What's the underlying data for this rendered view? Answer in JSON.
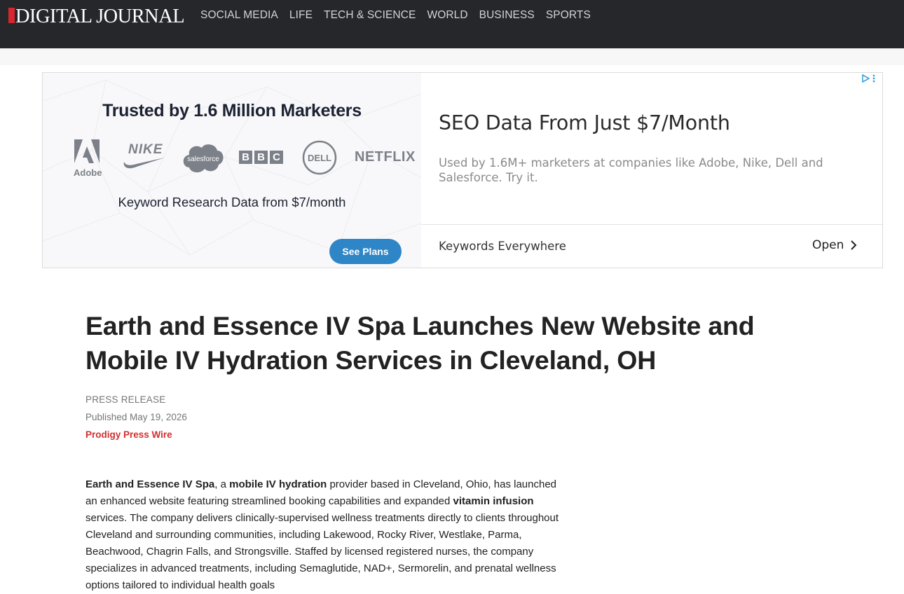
{
  "site": {
    "logo_text": "DIGITAL JOURNAL",
    "brand_color": "#d7262e",
    "nav": [
      "SOCIAL MEDIA",
      "LIFE",
      "TECH & SCIENCE",
      "WORLD",
      "BUSINESS",
      "SPORTS"
    ]
  },
  "ad": {
    "left": {
      "headline": "Trusted by 1.6 Million Marketers",
      "brands": [
        "Adobe",
        "NIKE",
        "salesforce",
        "BBC",
        "DELL",
        "NETFLIX"
      ],
      "subline": "Keyword Research Data from $7/month",
      "cta": "See Plans"
    },
    "right": {
      "title": "SEO Data From Just $7/Month",
      "description": "Used by 1.6M+ marketers at companies like Adobe, Nike, Dell and Salesforce. Try it.",
      "footer_label": "Keywords Everywhere",
      "open_label": "Open"
    }
  },
  "article": {
    "headline": "Earth and Essence IV Spa Launches New Website and Mobile IV Hydration Services in Cleveland, OH",
    "category": "PRESS RELEASE",
    "published": "Published May 19, 2026",
    "source": "Prodigy Press Wire",
    "paragraph": {
      "b1": "Earth and Essence IV Spa",
      "t1": ", a ",
      "b2": "mobile IV hydration",
      "t2": " provider based in Cleveland, Ohio, has launched an enhanced website featuring streamlined booking capabilities and expanded ",
      "b3": "vitamin infusion",
      "t3": " services. The company delivers clinically-supervised wellness treatments directly to clients throughout Cleveland and surrounding communities, including Lakewood, Rocky River, Westlake, Parma, Beachwood, Chagrin Falls, and Strongsville. Staffed by licensed registered nurses, the company specializes in advanced treatments, including Semaglutide, NAD+, Sermorelin, and prenatal wellness options tailored to individual health goals"
    }
  }
}
